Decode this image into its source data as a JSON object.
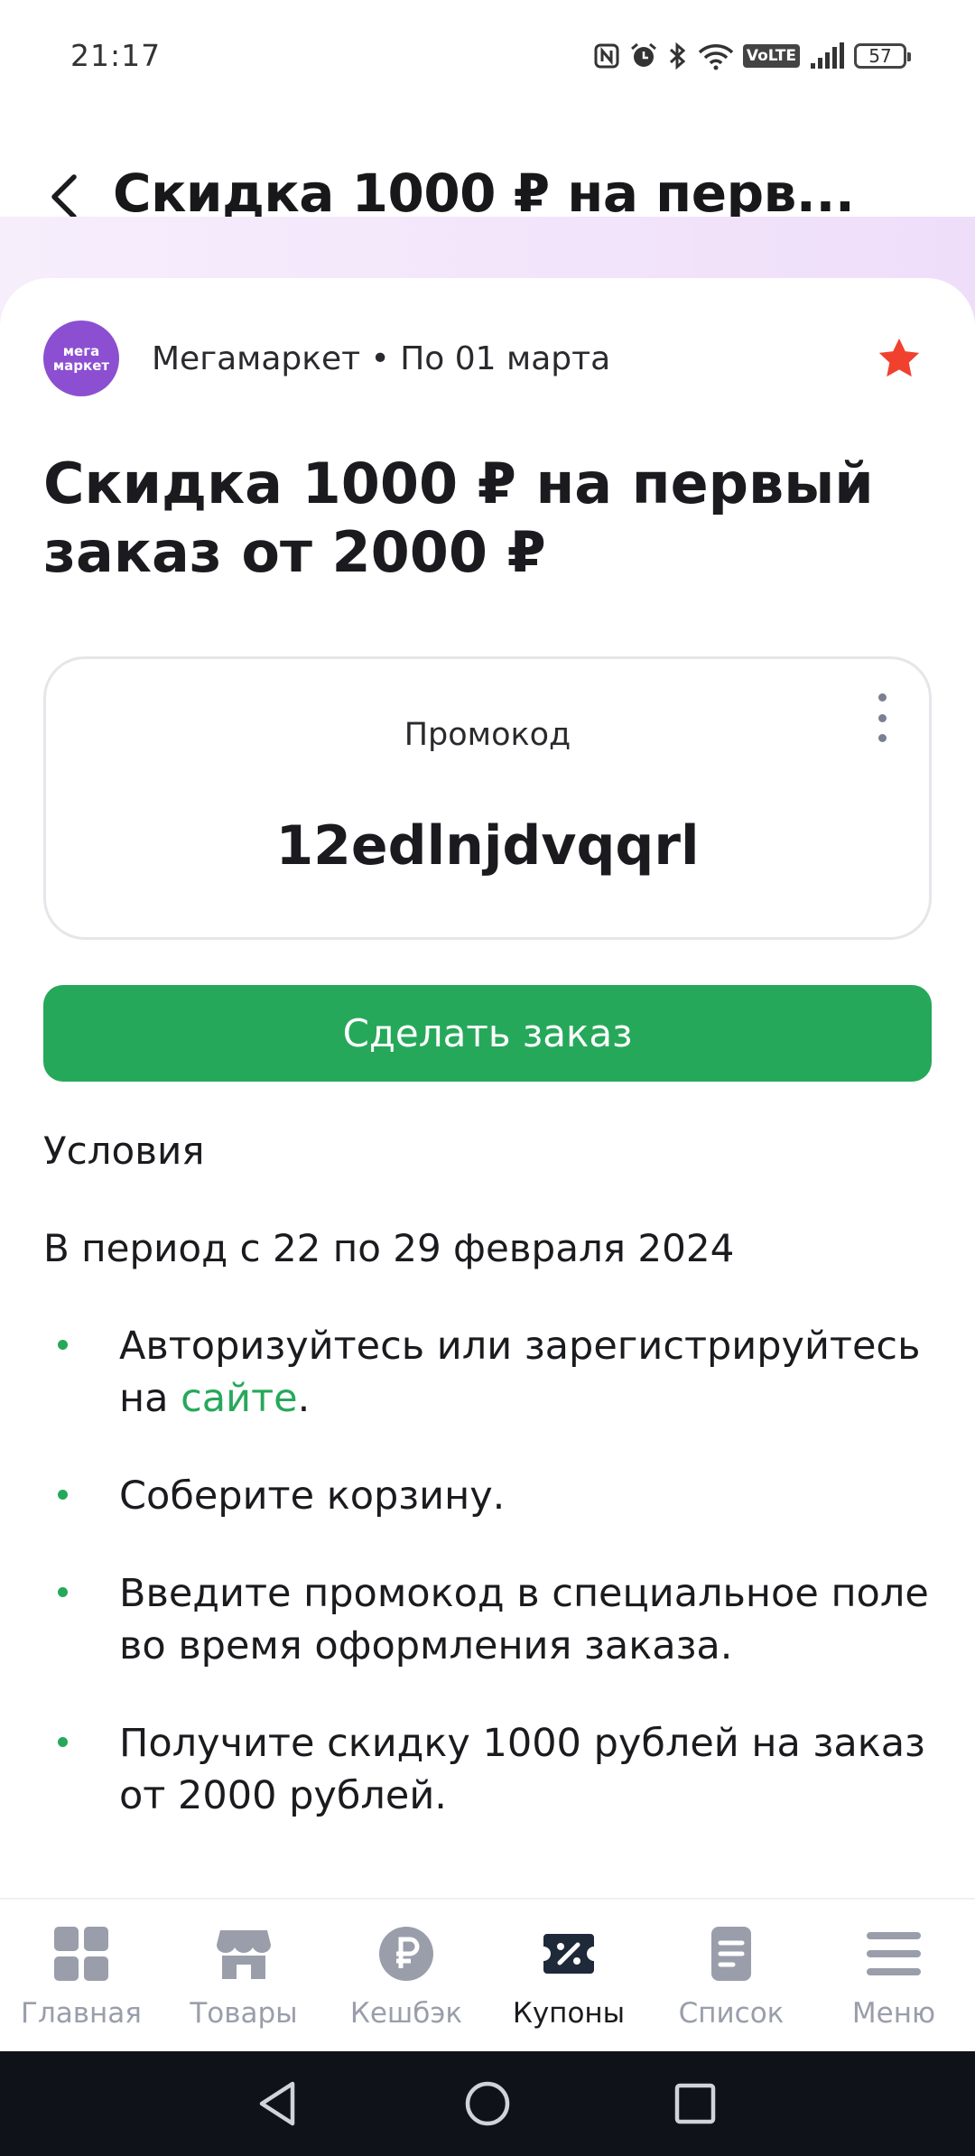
{
  "status_bar": {
    "time": "21:17",
    "volte": "VoLTE",
    "battery": "57"
  },
  "header": {
    "title": "Скидка 1000 ₽ на перв..."
  },
  "coupon": {
    "merchant_logo_text": "мега маркет",
    "merchant_info": "Мегамаркет • По 01 марта",
    "title": "Скидка 1000 ₽ на первый заказ от 2000 ₽",
    "promo_label": "Промокод",
    "promo_code": "12edlnjdvqqrl",
    "order_button": "Сделать заказ"
  },
  "conditions": {
    "title": "Условия",
    "period": "В период с 22 по 29 февраля 2024",
    "steps": [
      {
        "before": "Авторизуйтесь или зарегистрируйтесь на ",
        "link": "сайте",
        "after": "."
      },
      {
        "text": "Соберите корзину."
      },
      {
        "text": "Введите промокод в специальное поле во время оформления заказа."
      },
      {
        "text": "Получите скидку 1000 рублей на заказ от 2000 рублей."
      }
    ]
  },
  "bottom_nav": {
    "items": [
      {
        "label": "Главная",
        "icon": "home-grid-icon"
      },
      {
        "label": "Товары",
        "icon": "store-icon"
      },
      {
        "label": "Кешбэк",
        "icon": "ruble-coin-icon"
      },
      {
        "label": "Купоны",
        "icon": "coupon-percent-icon",
        "active": true
      },
      {
        "label": "Список",
        "icon": "list-doc-icon"
      },
      {
        "label": "Меню",
        "icon": "hamburger-icon"
      }
    ]
  },
  "colors": {
    "accent_green": "#26a85a",
    "merchant_purple": "#8c4fd1",
    "favorite_red": "#f0412f"
  }
}
